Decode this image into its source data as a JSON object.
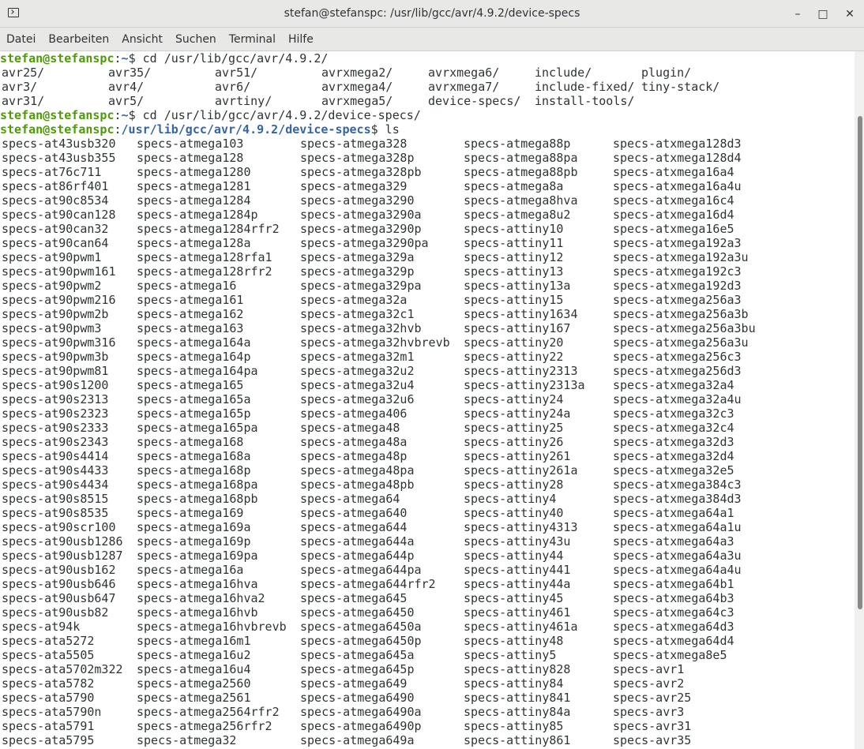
{
  "window": {
    "title": "stefan@stefanspc: /usr/lib/gcc/avr/4.9.2/device-specs",
    "minimize_glyph": "–",
    "maximize_glyph": "□",
    "close_glyph": "✕"
  },
  "menu": [
    "Datei",
    "Bearbeiten",
    "Ansicht",
    "Suchen",
    "Terminal",
    "Hilfe"
  ],
  "prompt": {
    "user": "stefan@stefanspc",
    "home_path": "~",
    "cwd_path": "/usr/lib/gcc/avr/4.9.2/device-specs"
  },
  "commands": [
    "cd /usr/lib/gcc/avr/4.9.2/",
    "cd /usr/lib/gcc/avr/4.9.2/device-specs/",
    "ls"
  ],
  "completion_rows": [
    [
      "avr25/",
      "avr35/",
      "avr51/",
      "avrxmega2/",
      "avrxmega6/",
      "include/",
      "plugin/"
    ],
    [
      "avr3/",
      "avr4/",
      "avr6/",
      "avrxmega4/",
      "avrxmega7/",
      "include-fixed/",
      "tiny-stack/"
    ],
    [
      "avr31/",
      "avr5/",
      "avrtiny/",
      "avrxmega5/",
      "device-specs/",
      "install-tools/",
      ""
    ]
  ],
  "ls_columns": [
    [
      "specs-at43usb320",
      "specs-at43usb355",
      "specs-at76c711",
      "specs-at86rf401",
      "specs-at90c8534",
      "specs-at90can128",
      "specs-at90can32",
      "specs-at90can64",
      "specs-at90pwm1",
      "specs-at90pwm161",
      "specs-at90pwm2",
      "specs-at90pwm216",
      "specs-at90pwm2b",
      "specs-at90pwm3",
      "specs-at90pwm316",
      "specs-at90pwm3b",
      "specs-at90pwm81",
      "specs-at90s1200",
      "specs-at90s2313",
      "specs-at90s2323",
      "specs-at90s2333",
      "specs-at90s2343",
      "specs-at90s4414",
      "specs-at90s4433",
      "specs-at90s4434",
      "specs-at90s8515",
      "specs-at90s8535",
      "specs-at90scr100",
      "specs-at90usb1286",
      "specs-at90usb1287",
      "specs-at90usb162",
      "specs-at90usb646",
      "specs-at90usb647",
      "specs-at90usb82",
      "specs-at94k",
      "specs-ata5272",
      "specs-ata5505",
      "specs-ata5702m322",
      "specs-ata5782",
      "specs-ata5790",
      "specs-ata5790n",
      "specs-ata5791",
      "specs-ata5795"
    ],
    [
      "specs-atmega103",
      "specs-atmega128",
      "specs-atmega1280",
      "specs-atmega1281",
      "specs-atmega1284",
      "specs-atmega1284p",
      "specs-atmega1284rfr2",
      "specs-atmega128a",
      "specs-atmega128rfa1",
      "specs-atmega128rfr2",
      "specs-atmega16",
      "specs-atmega161",
      "specs-atmega162",
      "specs-atmega163",
      "specs-atmega164a",
      "specs-atmega164p",
      "specs-atmega164pa",
      "specs-atmega165",
      "specs-atmega165a",
      "specs-atmega165p",
      "specs-atmega165pa",
      "specs-atmega168",
      "specs-atmega168a",
      "specs-atmega168p",
      "specs-atmega168pa",
      "specs-atmega168pb",
      "specs-atmega169",
      "specs-atmega169a",
      "specs-atmega169p",
      "specs-atmega169pa",
      "specs-atmega16a",
      "specs-atmega16hva",
      "specs-atmega16hva2",
      "specs-atmega16hvb",
      "specs-atmega16hvbrevb",
      "specs-atmega16m1",
      "specs-atmega16u2",
      "specs-atmega16u4",
      "specs-atmega2560",
      "specs-atmega2561",
      "specs-atmega2564rfr2",
      "specs-atmega256rfr2",
      "specs-atmega32"
    ],
    [
      "specs-atmega328",
      "specs-atmega328p",
      "specs-atmega328pb",
      "specs-atmega329",
      "specs-atmega3290",
      "specs-atmega3290a",
      "specs-atmega3290p",
      "specs-atmega3290pa",
      "specs-atmega329a",
      "specs-atmega329p",
      "specs-atmega329pa",
      "specs-atmega32a",
      "specs-atmega32c1",
      "specs-atmega32hvb",
      "specs-atmega32hvbrevb",
      "specs-atmega32m1",
      "specs-atmega32u2",
      "specs-atmega32u4",
      "specs-atmega32u6",
      "specs-atmega406",
      "specs-atmega48",
      "specs-atmega48a",
      "specs-atmega48p",
      "specs-atmega48pa",
      "specs-atmega48pb",
      "specs-atmega64",
      "specs-atmega640",
      "specs-atmega644",
      "specs-atmega644a",
      "specs-atmega644p",
      "specs-atmega644pa",
      "specs-atmega644rfr2",
      "specs-atmega645",
      "specs-atmega6450",
      "specs-atmega6450a",
      "specs-atmega6450p",
      "specs-atmega645a",
      "specs-atmega645p",
      "specs-atmega649",
      "specs-atmega6490",
      "specs-atmega6490a",
      "specs-atmega6490p",
      "specs-atmega649a"
    ],
    [
      "specs-atmega88p",
      "specs-atmega88pa",
      "specs-atmega88pb",
      "specs-atmega8a",
      "specs-atmega8hva",
      "specs-atmega8u2",
      "specs-attiny10",
      "specs-attiny11",
      "specs-attiny12",
      "specs-attiny13",
      "specs-attiny13a",
      "specs-attiny15",
      "specs-attiny1634",
      "specs-attiny167",
      "specs-attiny20",
      "specs-attiny22",
      "specs-attiny2313",
      "specs-attiny2313a",
      "specs-attiny24",
      "specs-attiny24a",
      "specs-attiny25",
      "specs-attiny26",
      "specs-attiny261",
      "specs-attiny261a",
      "specs-attiny28",
      "specs-attiny4",
      "specs-attiny40",
      "specs-attiny4313",
      "specs-attiny43u",
      "specs-attiny44",
      "specs-attiny441",
      "specs-attiny44a",
      "specs-attiny45",
      "specs-attiny461",
      "specs-attiny461a",
      "specs-attiny48",
      "specs-attiny5",
      "specs-attiny828",
      "specs-attiny84",
      "specs-attiny841",
      "specs-attiny84a",
      "specs-attiny85",
      "specs-attiny861"
    ],
    [
      "specs-atxmega128d3",
      "specs-atxmega128d4",
      "specs-atxmega16a4",
      "specs-atxmega16a4u",
      "specs-atxmega16c4",
      "specs-atxmega16d4",
      "specs-atxmega16e5",
      "specs-atxmega192a3",
      "specs-atxmega192a3u",
      "specs-atxmega192c3",
      "specs-atxmega192d3",
      "specs-atxmega256a3",
      "specs-atxmega256a3b",
      "specs-atxmega256a3bu",
      "specs-atxmega256a3u",
      "specs-atxmega256c3",
      "specs-atxmega256d3",
      "specs-atxmega32a4",
      "specs-atxmega32a4u",
      "specs-atxmega32c3",
      "specs-atxmega32c4",
      "specs-atxmega32d3",
      "specs-atxmega32d4",
      "specs-atxmega32e5",
      "specs-atxmega384c3",
      "specs-atxmega384d3",
      "specs-atxmega64a1",
      "specs-atxmega64a1u",
      "specs-atxmega64a3",
      "specs-atxmega64a3u",
      "specs-atxmega64a4u",
      "specs-atxmega64b1",
      "specs-atxmega64b3",
      "specs-atxmega64c3",
      "specs-atxmega64d3",
      "specs-atxmega64d4",
      "specs-atxmega8e5",
      "specs-avr1",
      "specs-avr2",
      "specs-avr25",
      "specs-avr3",
      "specs-avr31",
      "specs-avr35"
    ]
  ]
}
